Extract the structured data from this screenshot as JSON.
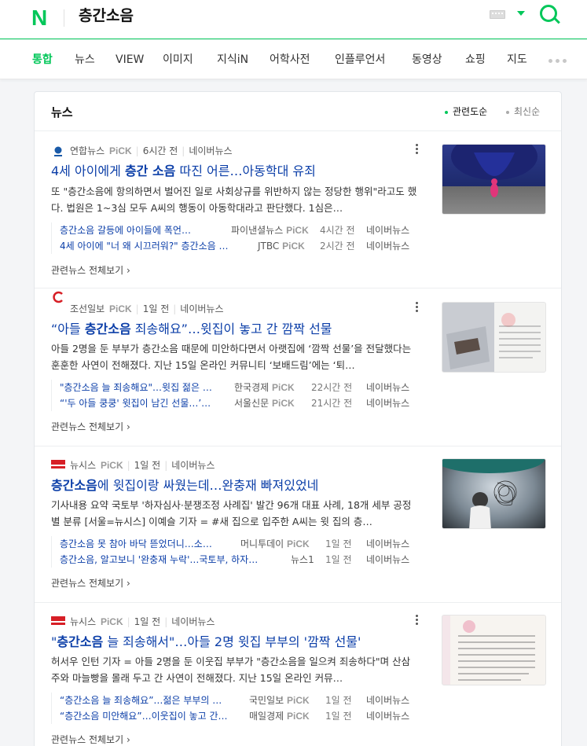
{
  "header": {
    "logo": "N",
    "query": "층간소음"
  },
  "tabs": [
    {
      "label": "통합",
      "active": true
    },
    {
      "label": "뉴스"
    },
    {
      "label": "VIEW"
    },
    {
      "label": "이미지"
    },
    {
      "label": "지식iN"
    },
    {
      "label": "어학사전"
    },
    {
      "label": "인플루언서"
    },
    {
      "label": "동영상"
    },
    {
      "label": "쇼핑"
    },
    {
      "label": "지도"
    }
  ],
  "section": {
    "title": "뉴스",
    "sort_relevance": "관련도순",
    "sort_latest": "최신순"
  },
  "pick_label": "PiCK",
  "naver_news": "네이버뉴스",
  "see_all": "관련뉴스 전체보기",
  "news": [
    {
      "press": "연합뉴스",
      "time": "6시간 전",
      "title_pre": "4세 아이에게 ",
      "title_hl": "층간 소음",
      "title_post": " 따진 어른…아동학대 유죄",
      "desc": "또 \"층간소음에 항의하면서 벌어진 일로 사회상규를 위반하지 않는 정당한 행위\"라고도 했다. 법원은 1~3심 모두 A씨의 행동이 아동학대라고 판단했다. 1심은…",
      "related": [
        {
          "title": "층간소음 갈등에 아이들에 폭언…",
          "press": "파이낸셜뉴스",
          "pick": true,
          "time": "4시간 전"
        },
        {
          "title": "4세 아이에 \"너 왜 시끄러워?\" 층간소음 …",
          "press": "JTBC",
          "pick": true,
          "time": "2시간 전"
        }
      ]
    },
    {
      "press": "조선일보",
      "time": "1일 전",
      "title_pre": "“아들 ",
      "title_hl": "층간소음",
      "title_post": " 죄송해요”…윗집이 놓고 간 깜짝 선물",
      "desc": "아들 2명을 둔 부부가 층간소음 때문에 미안하다면서 아랫집에 ‘깜짝 선물’을 전달했다는 훈훈한 사연이 전해졌다. 지난 15일 온라인 커뮤니티 ‘보배드림’에는 ‘퇴…",
      "related": [
        {
          "title": "\"층간소음 늘 죄송해요\"…윗집 젊은 …",
          "press": "한국경제",
          "pick": true,
          "time": "22시간 전"
        },
        {
          "title": "“'두 아들 쿵쿵' 윗집이 남긴 선물…’…",
          "press": "서울신문",
          "pick": true,
          "time": "21시간 전"
        }
      ]
    },
    {
      "press": "뉴시스",
      "time": "1일 전",
      "title_pre": "",
      "title_hl": "층간소음",
      "title_post": "에 윗집이랑 싸웠는데…완충재 빠져있었네",
      "desc": "기사내용 요약 국토부 '하자심사·분쟁조정 사례집' 발간 96개 대표 사례, 18개 세부 공정별 분류 [서울=뉴시스] 이예슬 기자 = #새 집으로 입주한 A씨는 윗 집의 층…",
      "related": [
        {
          "title": "층간소음 못 참아 바닥 뜯었더니…소…",
          "press": "머니투데이",
          "pick": true,
          "time": "1일 전"
        },
        {
          "title": "층간소음, 알고보니 '완충재 누락'…국토부, 하자…",
          "press": "뉴스1",
          "pick": false,
          "time": "1일 전"
        }
      ]
    },
    {
      "press": "뉴시스",
      "time": "1일 전",
      "title_pre": "\"",
      "title_hl": "층간소음",
      "title_post": " 늘 죄송해서\"…아들 2명 윗집 부부의 '깜짝 선물'",
      "desc": "허서우 인턴 기자 = 아들 2명을 둔 이웃집 부부가 \"층간소음을 일으켜 죄송하다\"며 산삼주와 마늘빵을 몰래 두고 간 사연이 전해졌다. 지난 15일 온라인 커뮤…",
      "related": [
        {
          "title": "“층간소음 늘 죄송해요”…젊은 부부의 …",
          "press": "국민일보",
          "pick": true,
          "time": "1일 전"
        },
        {
          "title": "“층간소음 미안해요”…이웃집이 놓고 간…",
          "press": "매일경제",
          "pick": true,
          "time": "1일 전"
        }
      ]
    }
  ],
  "colors": {
    "brand": "#03c75a",
    "link": "#0b3ea8"
  }
}
